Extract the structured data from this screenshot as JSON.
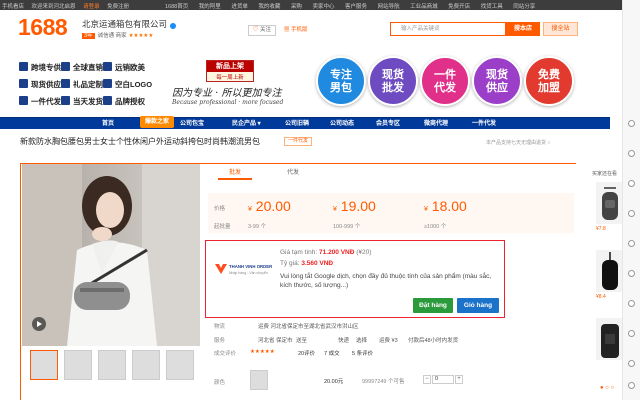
{
  "topbar": {
    "left": [
      "手机看店",
      "欢迎来到河北启恩",
      "请登录",
      "免费注册"
    ],
    "right": [
      "1688首页",
      "我的阿里",
      "进货单",
      "我的收藏",
      "采购",
      "卖家中心",
      "客户服务",
      "网站导航",
      "工业品商城",
      "免费开店",
      "找货工具",
      "同站分享"
    ]
  },
  "header": {
    "logo": "1688",
    "company": "北京运通箱包有限公司",
    "company_badge": "3年",
    "company_sub": "诚信通 商家",
    "stars": "★★★★★",
    "follow": "关注",
    "mobile_shop": "手机版",
    "search_placeholder": "输入产品关键词",
    "search_btn": "搜本店",
    "search_site": "搜全站"
  },
  "features": [
    [
      "跨境专供",
      "全球直销",
      "远销欧美"
    ],
    [
      "现货供应",
      "礼品定制",
      "空白LOGO"
    ],
    [
      "一件代发",
      "当天发货",
      "品牌授权"
    ]
  ],
  "banner": {
    "new_title": "新品上架",
    "new_sub": "每一周上新",
    "slogan": "因为专业 · 所以更加专注",
    "slogan_en": "Because professional · more focused",
    "circles": [
      {
        "l1": "专注",
        "l2": "男包",
        "color": "#1f8ae0"
      },
      {
        "l1": "现货",
        "l2": "批发",
        "color": "#6e4bc0"
      },
      {
        "l1": "一件",
        "l2": "代发",
        "color": "#e0308a"
      },
      {
        "l1": "现货",
        "l2": "供应",
        "color": "#9b3fc9"
      },
      {
        "l1": "免费",
        "l2": "加盟",
        "color": "#e23a2f"
      }
    ]
  },
  "nav": {
    "items": [
      "首页",
      "公司包宝",
      "公司包宝",
      "民企产品 ▾",
      "公司旧辆",
      "公司动态",
      "会员专区",
      "微商代理",
      "一件代发"
    ],
    "hot": "爆款之家"
  },
  "product": {
    "title": "新款防水胸包腰包男士女士个性休闲户外运动斜挎包时尚韩潮流男包",
    "title_btn": "一件代发",
    "sample_tip": "本产品支持七天无理由退货 ○"
  },
  "tabs": [
    "批发",
    "代发"
  ],
  "prices": {
    "label": "价格",
    "qty_label": "起批量",
    "currency": "¥",
    "tiers": [
      {
        "price": "20.00",
        "qty": "3-99 个"
      },
      {
        "price": "19.00",
        "qty": "100-999 个"
      },
      {
        "price": "18.00",
        "qty": "≥1000 个"
      }
    ]
  },
  "popup": {
    "line1_pre": "Giá tạm tính:",
    "line1_val": "71.200 VNĐ",
    "line1_post": "(¥20)",
    "line2_pre": "Tỷ giá:",
    "line2_val": "3.560 VNĐ",
    "note": "Vui lòng tắt Google dịch, chọn đầy đủ thuộc tính của sản phẩm (màu sắc, kích thước, số lượng...)",
    "logo_text": "THANH VINH ORDER",
    "logo_sub": "Nhập hàng - Vận chuyển",
    "order_btn": "Đặt hàng",
    "cart_btn": "Giỏ hàng"
  },
  "details": {
    "shipping_label": "物流",
    "shipping_text": "运费 河北省保定市至湖北省武汉市洪山区",
    "shipping_from": "河北省 保定市",
    "send_to": "送至",
    "method": "快递",
    "method_choice": "选择",
    "fee": "运费 ¥3",
    "promise": "付款后48小时内发货",
    "service": "服务",
    "review_label": "成交评价",
    "review_stars": "★★★★★",
    "review_count": "20评价",
    "deals": "7 成交",
    "deals_unit": "5 条评价",
    "color_label": "颜色",
    "sku_price": "20.00元",
    "sku_stock": "99997249 个可售",
    "sku_minus": "−",
    "sku_qty": "0",
    "sku_plus": "+"
  },
  "right_panel": {
    "title": "买家还在看",
    "items": [
      {
        "price": "¥7.8"
      },
      {
        "price": "¥8.4"
      },
      {
        "price": ""
      }
    ]
  }
}
